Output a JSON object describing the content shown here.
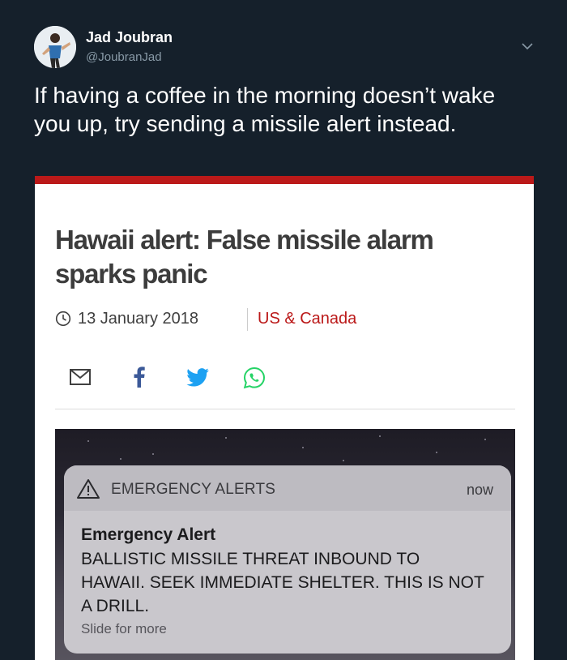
{
  "tweet": {
    "author_name": "Jad Joubran",
    "author_handle": "@JoubranJad",
    "text": "If having a coffee in the morning doesn’t wake you up, try sending a missile alert instead."
  },
  "article": {
    "headline": "Hawaii alert: False missile alarm sparks panic",
    "date": "13 January 2018",
    "section": "US & Canada",
    "share_icons": [
      "email-icon",
      "facebook-icon",
      "twitter-icon",
      "whatsapp-icon"
    ],
    "accent_color": "#bb1919"
  },
  "alert": {
    "app_name": "EMERGENCY ALERTS",
    "time": "now",
    "title": "Emergency Alert",
    "body": "BALLISTIC MISSILE THREAT INBOUND TO HAWAII. SEEK IMMEDIATE SHELTER. THIS IS NOT A DRILL.",
    "footer": "Slide for more"
  },
  "colors": {
    "background": "#15202b",
    "secondary_text": "#8899a6"
  }
}
